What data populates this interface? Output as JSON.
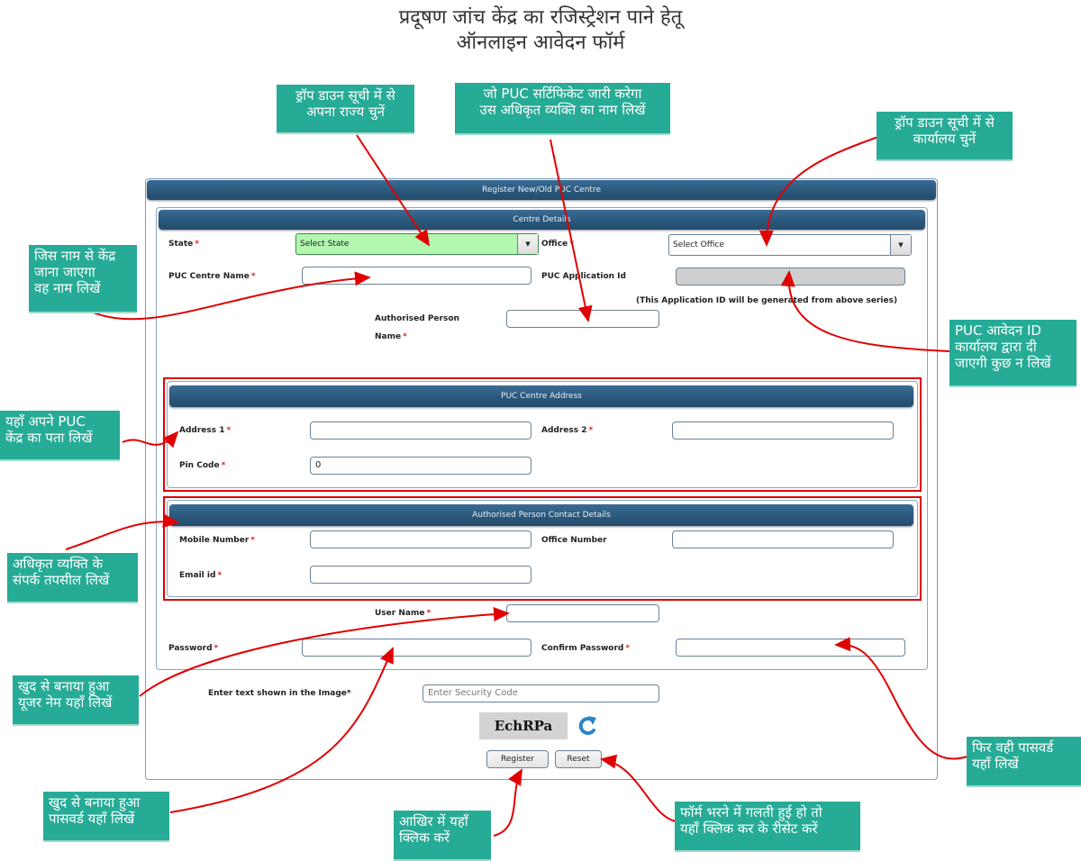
{
  "title": {
    "line1": "प्रदूषण जांच केंद्र का रजिस्ट्रेशन पाने हेतू",
    "line2": "ऑनलाइन आवेदन फॉर्म"
  },
  "callouts": {
    "state": "ड्रॉप डाउन सूची में से\nअपना राज्य चुनें",
    "authorised_name": "जो PUC सर्टिफिकेट जारी करेगा\nउस अधिकृत व्यक्ति का नाम लिखें",
    "office": "ड्रॉप डाउन सूची में से\nकार्यालय चुनें",
    "centre_name": "जिस नाम से केंद्र\nजाना जाएगा\nवह नाम लिखें",
    "application_id": "PUC आवेदन ID\nकार्यालय द्वारा दी\nजाएगी कुछ न लिखें",
    "address": "यहाँ अपने PUC\nकेंद्र का पता लिखें",
    "contact": "अधिकृत व्यक्ति के\nसंपर्क तपसील लिखें",
    "username": "खुद से बनाया हुआ\nयूजर नेम यहाँ लिखें",
    "password": "खुद से बनाया हुआ\nपासवर्ड यहाँ लिखें",
    "confirm_password": "फिर वही पासवर्ड\nयहाँ लिखें",
    "register": "आखिर में यहाँ\nक्लिक करें",
    "reset": "फॉर्म भरने में गलती हुई हो तो\nयहाँ क्लिक कर के रीसेट करें"
  },
  "form": {
    "header": "Register New/Old PUC Centre",
    "centre_details": {
      "header": "Centre Details",
      "state_label": "State",
      "state_value": "Select State",
      "office_label": "Office",
      "office_value": "Select Office",
      "centre_name_label": "PUC Centre Name",
      "centre_name_value": "",
      "application_id_label": "PUC Application Id",
      "application_id_value": "",
      "application_id_hint": "(This Application ID will be generated from above series)",
      "authorised_label_1": "Authorised Person",
      "authorised_label_2": "Name",
      "authorised_value": ""
    },
    "address": {
      "header": "PUC Centre Address",
      "address1_label": "Address 1",
      "address1_value": "",
      "address2_label": "Address 2",
      "address2_value": "",
      "pincode_label": "Pin Code",
      "pincode_value": "0"
    },
    "contact": {
      "header": "Authorised Person Contact Details",
      "mobile_label": "Mobile Number",
      "mobile_value": "",
      "office_number_label": "Office Number",
      "office_number_value": "",
      "email_label": "Email id",
      "email_value": ""
    },
    "account": {
      "username_label": "User Name",
      "username_value": "",
      "password_label": "Password",
      "password_value": "",
      "confirm_label": "Confirm Password",
      "confirm_value": ""
    },
    "captcha": {
      "label": "Enter text shown in the Image*",
      "placeholder": "Enter Security Code",
      "code": "EchRPa"
    },
    "buttons": {
      "register": "Register",
      "reset": "Reset"
    },
    "required_mark": "*"
  },
  "colors": {
    "callout_bg": "#26ab96",
    "header_bar": "#2a5679",
    "annotation_red": "#e00000",
    "state_select_bg": "#b3f7b0"
  }
}
